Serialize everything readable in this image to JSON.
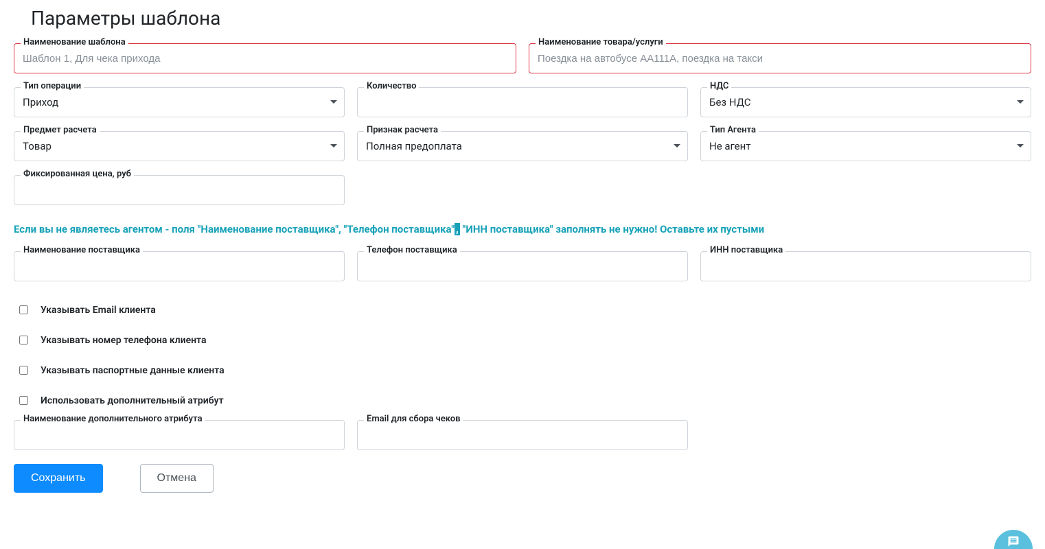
{
  "title": "Параметры шаблона",
  "fields": {
    "template_name": {
      "label": "Наименование шаблона",
      "placeholder": "Шаблон 1, Для чека прихода",
      "value": ""
    },
    "product_name": {
      "label": "Наименование товара/услуги",
      "placeholder": "Поездка на автобусе АА111А, поездка на такси",
      "value": ""
    },
    "operation_type": {
      "label": "Тип операции",
      "value": "Приход"
    },
    "quantity": {
      "label": "Количество",
      "value": ""
    },
    "vat": {
      "label": "НДС",
      "value": "Без НДС"
    },
    "payment_subject": {
      "label": "Предмет расчета",
      "value": "Товар"
    },
    "payment_method": {
      "label": "Признак расчета",
      "value": "Полная предоплата"
    },
    "agent_type": {
      "label": "Тип Агента",
      "value": "Не агент"
    },
    "fixed_price": {
      "label": "Фиксированная цена, руб",
      "value": ""
    },
    "supplier_name": {
      "label": "Наименование поставщика",
      "value": ""
    },
    "supplier_phone": {
      "label": "Телефон поставщика",
      "value": ""
    },
    "supplier_inn": {
      "label": "ИНН поставщика",
      "value": ""
    },
    "additional_attr_name": {
      "label": "Наименование дополнительного атрибута",
      "value": ""
    },
    "email_receipts": {
      "label": "Email для сбора чеков",
      "value": ""
    }
  },
  "hint": {
    "part1": "Если вы не являетесь агентом - поля \"Наименование поставщика\", \"Телефон поставщика\"",
    "highlighted": ",",
    "part2": " \"ИНН поставщика\" заполнять не нужно! Оставьте их пустыми"
  },
  "checkboxes": {
    "show_email": "Указывать Email клиента",
    "show_phone": "Указывать номер телефона клиента",
    "show_passport": "Указывать паспортные данные клиента",
    "use_additional": "Использовать дополнительный атрибут"
  },
  "buttons": {
    "save": "Сохранить",
    "cancel": "Отмена"
  }
}
